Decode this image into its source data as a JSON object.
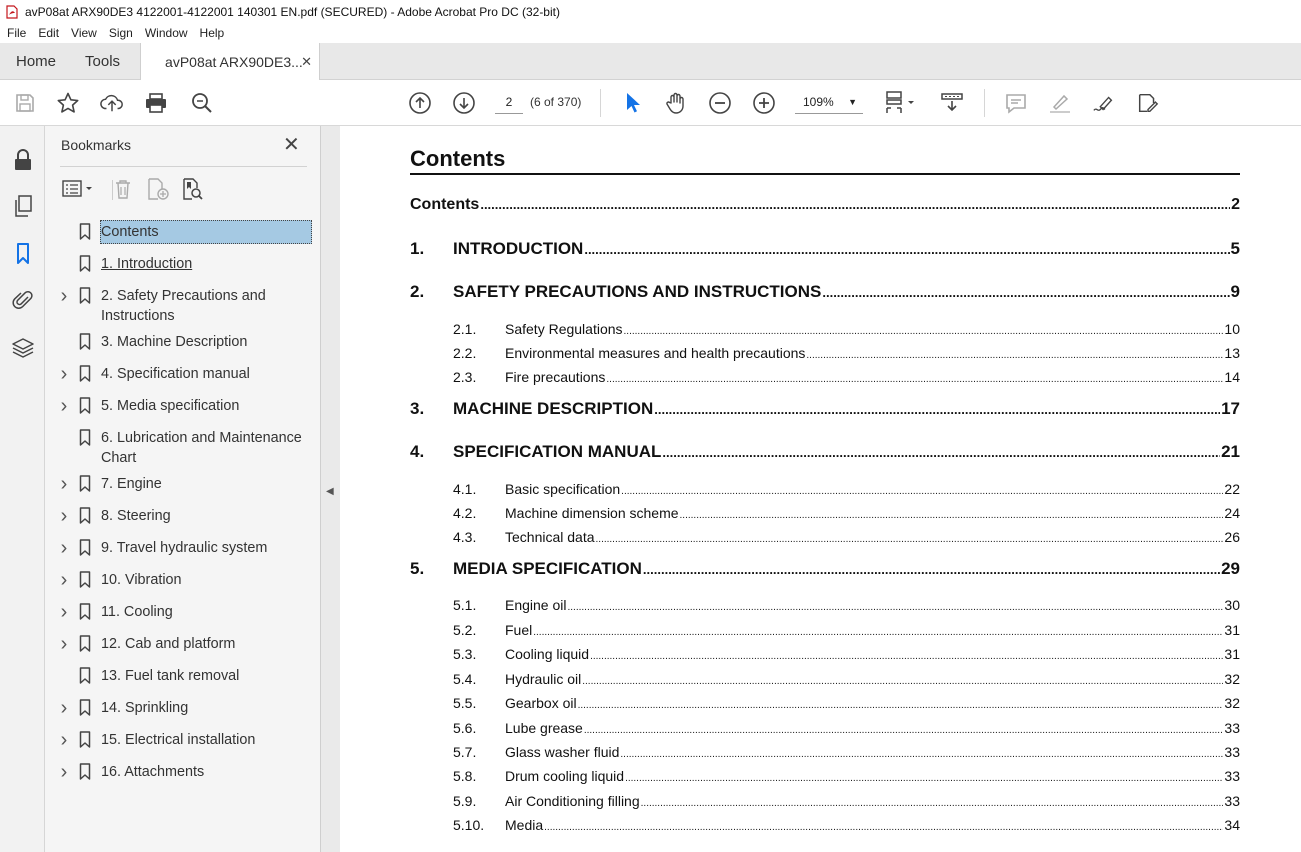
{
  "window": {
    "title": "avP08at ARX90DE3 4122001-4122001 140301 EN.pdf (SECURED) - Adobe Acrobat Pro DC (32-bit)"
  },
  "menu": [
    "File",
    "Edit",
    "View",
    "Sign",
    "Window",
    "Help"
  ],
  "tabs": {
    "home": "Home",
    "tools": "Tools",
    "doc": "avP08at ARX90DE3..."
  },
  "toolbar": {
    "page_number": "2",
    "page_count": "(6 of 370)",
    "zoom": "109%"
  },
  "colors": {
    "accent": "#1473e6",
    "selection": "#a5c9e3"
  },
  "bookmarks": {
    "header": "Bookmarks",
    "items": [
      {
        "label": "Contents",
        "expandable": false,
        "selected": true
      },
      {
        "label": "1. Introduction ",
        "expandable": false,
        "linked": true
      },
      {
        "label": "2. Safety Precautions and Instructions",
        "expandable": true
      },
      {
        "label": "3. Machine Description",
        "expandable": false
      },
      {
        "label": "4. Specification manual",
        "expandable": true
      },
      {
        "label": "5. Media specification",
        "expandable": true
      },
      {
        "label": "6. Lubrication and Maintenance Chart",
        "expandable": false
      },
      {
        "label": "7. Engine",
        "expandable": true
      },
      {
        "label": "8. Steering",
        "expandable": true
      },
      {
        "label": "9. Travel hydraulic system",
        "expandable": true
      },
      {
        "label": "10. Vibration",
        "expandable": true
      },
      {
        "label": "11. Cooling",
        "expandable": true
      },
      {
        "label": "12. Cab and platform",
        "expandable": true
      },
      {
        "label": "13. Fuel tank removal",
        "expandable": false
      },
      {
        "label": "14. Sprinkling",
        "expandable": true
      },
      {
        "label": "15. Electrical installation",
        "expandable": true
      },
      {
        "label": "16. Attachments",
        "expandable": true
      }
    ]
  },
  "document": {
    "heading": "Contents",
    "toc": [
      {
        "level": 0,
        "num": "",
        "text": "Contents",
        "page": "2"
      },
      {
        "level": 1,
        "num": "1.",
        "text": "INTRODUCTION",
        "page": "5"
      },
      {
        "level": 1,
        "num": "2.",
        "text": "SAFETY PRECAUTIONS AND INSTRUCTIONS",
        "page": "9"
      },
      {
        "level": 2,
        "num": "2.1.",
        "text": "Safety Regulations",
        "page": "10"
      },
      {
        "level": 2,
        "num": "2.2.",
        "text": "Environmental measures and health precautions",
        "page": "13"
      },
      {
        "level": 2,
        "num": "2.3.",
        "text": "Fire precautions",
        "page": "14"
      },
      {
        "level": 1,
        "num": "3.",
        "text": "MACHINE DESCRIPTION",
        "page": "17"
      },
      {
        "level": 1,
        "num": "4.",
        "text": "SPECIFICATION MANUAL",
        "page": "21"
      },
      {
        "level": 2,
        "num": "4.1.",
        "text": "Basic specification",
        "page": "22"
      },
      {
        "level": 2,
        "num": "4.2.",
        "text": "Machine dimension scheme",
        "page": "24"
      },
      {
        "level": 2,
        "num": "4.3.",
        "text": "Technical data",
        "page": "26"
      },
      {
        "level": 1,
        "num": "5.",
        "text": "MEDIA SPECIFICATION",
        "page": "29"
      },
      {
        "level": 2,
        "num": "5.1.",
        "text": "Engine oil",
        "page": "30"
      },
      {
        "level": 2,
        "num": "5.2.",
        "text": "Fuel",
        "page": "31"
      },
      {
        "level": 2,
        "num": "5.3.",
        "text": "Cooling liquid",
        "page": "31"
      },
      {
        "level": 2,
        "num": "5.4.",
        "text": "Hydraulic oil",
        "page": "32"
      },
      {
        "level": 2,
        "num": "5.5.",
        "text": "Gearbox oil",
        "page": "32"
      },
      {
        "level": 2,
        "num": "5.6.",
        "text": "Lube grease",
        "page": "33"
      },
      {
        "level": 2,
        "num": "5.7.",
        "text": "Glass washer fluid",
        "page": "33"
      },
      {
        "level": 2,
        "num": "5.8.",
        "text": "Drum cooling liquid",
        "page": "33"
      },
      {
        "level": 2,
        "num": "5.9.",
        "text": "Air Conditioning filling",
        "page": "33"
      },
      {
        "level": 2,
        "num": "5.10.",
        "text": "Media",
        "page": "34"
      }
    ]
  }
}
